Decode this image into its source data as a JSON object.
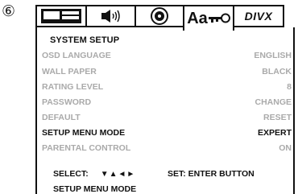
{
  "step_marker": "⑥",
  "tabs": [
    {
      "icon": "display-setup-icon"
    },
    {
      "icon": "audio-speaker-icon"
    },
    {
      "icon": "disc-icon"
    },
    {
      "icon": "language-key-icon",
      "text": "Aa"
    },
    {
      "icon": "divx-logo-icon",
      "text": "DIVX"
    }
  ],
  "menu": {
    "title": "SYSTEM SETUP",
    "items": [
      {
        "label": "OSD LANGUAGE",
        "value": "ENGLISH",
        "active": false
      },
      {
        "label": "WALL PAPER",
        "value": "BLACK",
        "active": false
      },
      {
        "label": "RATING LEVEL",
        "value": "8",
        "active": false
      },
      {
        "label": "PASSWORD",
        "value": "CHANGE",
        "active": false
      },
      {
        "label": "DEFAULT",
        "value": "RESET",
        "active": false
      },
      {
        "label": "SETUP MENU MODE",
        "value": "EXPERT",
        "active": true
      },
      {
        "label": "PARENTAL CONTROL",
        "value": "ON",
        "active": false
      }
    ]
  },
  "footer": {
    "select_label": "SELECT:",
    "select_arrows": "▼▲◄►",
    "set_label": "SET: ENTER BUTTON",
    "status": "SETUP MENU MODE"
  },
  "colors": {
    "active_text": "#111111",
    "inactive_text": "#aaaaaa"
  }
}
